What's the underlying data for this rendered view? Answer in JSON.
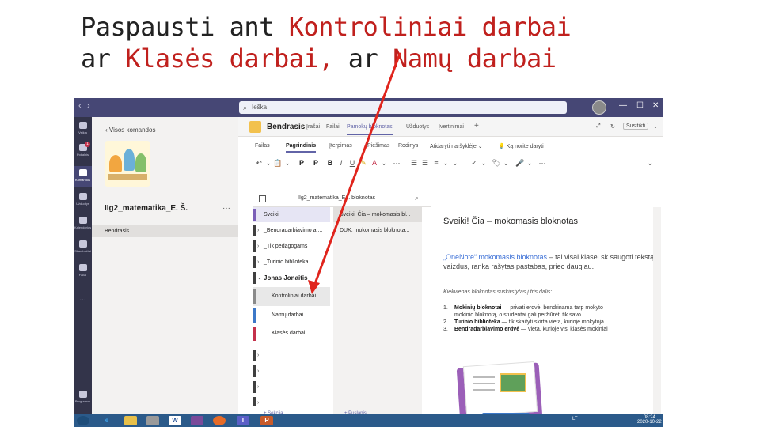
{
  "caption": {
    "line1_a": "Paspausti ant ",
    "line1_b": "Kontroliniai darbai",
    "line2_a": "ar ",
    "line2_b": "Klasės darbai,",
    "line2_c": " ar ",
    "line2_d": "Namų darbai"
  },
  "titlebar": {
    "back": "‹",
    "forward": "›",
    "search_placeholder": "Ieška",
    "minimize": "—",
    "maximize": "☐",
    "close": "✕"
  },
  "rail": [
    {
      "label": "Veikla",
      "icon": "bell-icon"
    },
    {
      "label": "Pokalbis",
      "icon": "chat-icon",
      "badge": "1"
    },
    {
      "label": "Komandos",
      "icon": "teams-icon",
      "active": true
    },
    {
      "label": "Užduotys",
      "icon": "assignments-icon"
    },
    {
      "label": "Kalendorius",
      "icon": "calendar-icon"
    },
    {
      "label": "Skambučiai",
      "icon": "calls-icon"
    },
    {
      "label": "Failai",
      "icon": "files-icon"
    },
    {
      "label": "...",
      "icon": "more-icon"
    },
    {
      "label": "Programos",
      "icon": "apps-icon"
    },
    {
      "label": "Žinynas",
      "icon": "help-icon"
    }
  ],
  "teams_panel": {
    "back_label": "‹  Visos komandos",
    "team_name": "IIg2_matematika_E. Š.",
    "more": "···",
    "channel": "Bendrasis"
  },
  "tabs_bar": {
    "team": "Bendrasis",
    "tabs": [
      {
        "label": "Įrašai",
        "active": false
      },
      {
        "label": "Failai",
        "active": false
      },
      {
        "label": "Pamokų bloknotas",
        "active": true
      },
      {
        "label": "Užduotys",
        "active": false
      },
      {
        "label": "Įvertinimai",
        "active": false
      }
    ],
    "add": "+",
    "right": [
      "⤢",
      "↻",
      "Susitikti",
      "⌄"
    ]
  },
  "ribbon_tabs": [
    {
      "label": "Failas",
      "active": false
    },
    {
      "label": "Pagrindinis",
      "active": true
    },
    {
      "label": "Įterpimas",
      "active": false
    },
    {
      "label": "Piešimas",
      "active": false
    },
    {
      "label": "Rodinys",
      "active": false
    },
    {
      "label": "Atidaryti naršyklėje ⌄",
      "active": false
    },
    {
      "label": "💡 Ką norite daryti",
      "active": false
    }
  ],
  "ribbon_icons": [
    "↶",
    "⌄",
    "📋",
    "⌄",
    "P",
    "P",
    "B",
    "I",
    "U",
    "✎",
    "A",
    "⌄",
    "···",
    "☰",
    "☰",
    "≡",
    "⌄",
    "⌄",
    "✓",
    "⌄",
    "🏷",
    "⌄",
    "🎤",
    "⌄",
    "···",
    "⌄"
  ],
  "notebook": {
    "name": "IIg2_matematika_E... bloknotas",
    "sections": [
      {
        "label": "Sveiki!",
        "type": "active",
        "color": "#7b5fb8"
      },
      {
        "label": "_Bendradarbiavimo ar...",
        "type": "collapsed",
        "color": "#3f3f3f"
      },
      {
        "label": "_Tik pedagogams",
        "type": "collapsed",
        "color": "#3f3f3f"
      },
      {
        "label": "_Turinio biblioteka",
        "type": "collapsed",
        "color": "#3f3f3f"
      },
      {
        "label": "Jonas Jonaitis",
        "type": "expanded",
        "color": "#3f3f3f"
      },
      {
        "label": "Kontroliniai darbai",
        "type": "sub-active",
        "color": "#8a8a8a"
      },
      {
        "label": "Namų darbai",
        "type": "sub",
        "color": "#3c78c8"
      },
      {
        "label": "Klasės darbai",
        "type": "sub",
        "color": "#c4314b"
      },
      {
        "label": "",
        "type": "collapsed",
        "color": "#3f3f3f"
      },
      {
        "label": "",
        "type": "collapsed",
        "color": "#3f3f3f"
      },
      {
        "label": "",
        "type": "collapsed",
        "color": "#3f3f3f"
      },
      {
        "label": "",
        "type": "collapsed",
        "color": "#3f3f3f"
      },
      {
        "label": "",
        "type": "collapsed",
        "color": "#3f3f3f"
      }
    ],
    "add_section": "+ Sekcija",
    "pages": [
      {
        "label": "Sveiki! Čia – mokomasis bl...",
        "active": true
      },
      {
        "label": "DUK: mokomasis bloknota...",
        "active": false
      }
    ],
    "add_page": "+ Puslapis"
  },
  "page": {
    "title": "Sveiki! Čia – mokomasis bloknotas",
    "intro_link": "„OneNote“ mokomasis bloknotas",
    "intro_rest": " – tai visai klasei sk saugoti tekstą, vaizdus, ranka rašytas pastabas, priec daugiau.",
    "kiekvienas": "Kiekvienas bloknotas suskirstytas į tris dalis:",
    "items": [
      {
        "num": "1.",
        "bold": "Mokinių bloknotai",
        "rest": " — privati erdvė, bendrinama tarp mokyto",
        "line2": "mokinio bloknotą, o studentai gali peržiūrėti tik savo."
      },
      {
        "num": "2.",
        "bold": "Turinio biblioteka",
        "rest": " — tik skaityti skirta vieta, kurioje mokytoja",
        "line2": ""
      },
      {
        "num": "3.",
        "bold": "Bendradarbiavimo erdvė",
        "rest": " — vieta, kurioje visi klasės mokiniai",
        "line2": ""
      }
    ]
  },
  "taskbar": {
    "lang": "LT",
    "time": "08:24",
    "date": "2020-10-22"
  }
}
